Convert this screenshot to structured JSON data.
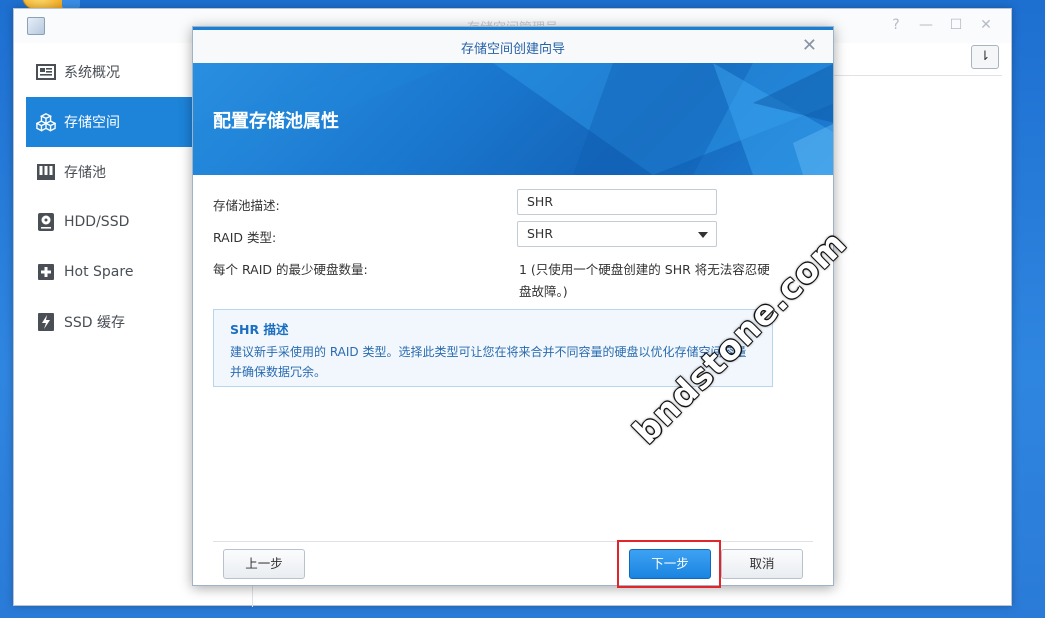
{
  "window": {
    "title": "存储空间管理员",
    "controls": {
      "help": "?",
      "minimize": "—",
      "maximize": "☐",
      "close": "✕"
    },
    "sort_button": "⇂"
  },
  "sidebar": {
    "items": [
      {
        "label": "系统概况",
        "icon": "system-overview-icon",
        "active": false
      },
      {
        "label": "存储空间",
        "icon": "storage-volume-icon",
        "active": true
      },
      {
        "label": "存储池",
        "icon": "storage-pool-icon",
        "active": false
      },
      {
        "label": "HDD/SSD",
        "icon": "hdd-icon",
        "active": false
      },
      {
        "label": "Hot Spare",
        "icon": "hot-spare-icon",
        "active": false
      },
      {
        "label": "SSD 缓存",
        "icon": "ssd-cache-icon",
        "active": false
      }
    ]
  },
  "dialog": {
    "title": "存储空间创建向导",
    "close": "✕",
    "banner_title": "配置存储池属性",
    "fields": {
      "description_label": "存储池描述:",
      "description_value": "SHR",
      "raid_type_label": "RAID 类型:",
      "raid_type_value": "SHR",
      "min_disks_label": "每个 RAID 的最少硬盘数量:",
      "min_disks_value_line1": "1 (只使用一个硬盘创建的 SHR 将无法容忍硬",
      "min_disks_value_line2": "盘故障。)"
    },
    "info": {
      "title": "SHR 描述",
      "text_line1": "建议新手采使用的 RAID 类型。选择此类型可让您在将来合并不同容量的硬盘以优化存储空间容量",
      "text_line2": "并确保数据冗余。"
    },
    "buttons": {
      "prev": "上一步",
      "next": "下一步",
      "cancel": "取消"
    }
  },
  "watermark": "bndstone.com",
  "colors": {
    "accent": "#1d84da",
    "highlight": "#e0262a"
  }
}
